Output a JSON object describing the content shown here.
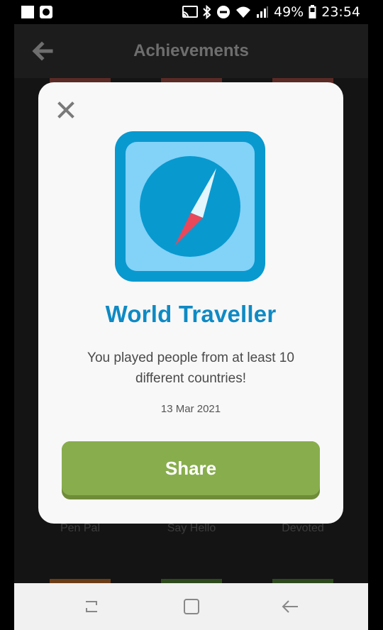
{
  "status_bar": {
    "battery": "49%",
    "time": "23:54"
  },
  "app": {
    "title": "Achievements",
    "achievements": [
      "Pen Pal",
      "Say Hello",
      "Devoted"
    ]
  },
  "modal": {
    "badge_icon": "compass-icon",
    "title": "World Traveller",
    "description": "You played people from at least 10 different countries!",
    "date": "13 Mar 2021",
    "share_label": "Share"
  },
  "colors": {
    "title_blue": "#0e8ac4",
    "badge_dark": "#0899cf",
    "badge_light": "#83d2f8",
    "share_green": "#88ad4d",
    "needle_red": "#e8485a"
  }
}
